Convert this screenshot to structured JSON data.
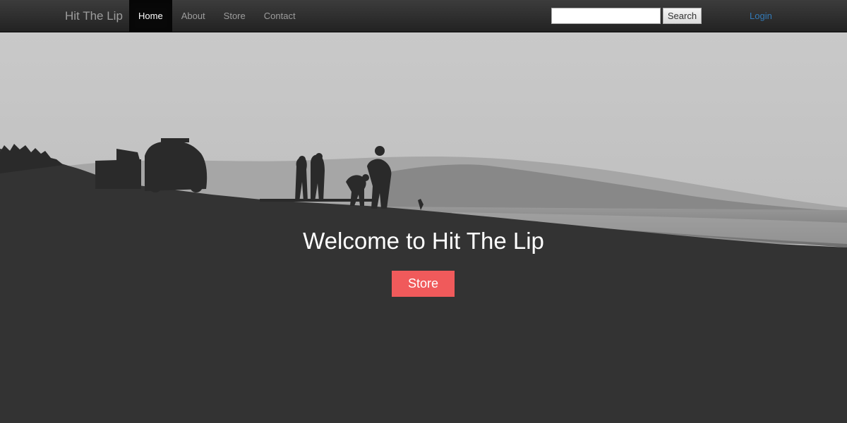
{
  "navbar": {
    "brand": "Hit The Lip",
    "items": [
      {
        "label": "Home",
        "active": true
      },
      {
        "label": "About",
        "active": false
      },
      {
        "label": "Store",
        "active": false
      },
      {
        "label": "Contact",
        "active": false
      }
    ],
    "search": {
      "value": "",
      "placeholder": "",
      "button_label": "Search"
    },
    "login_label": "Login"
  },
  "hero": {
    "title": "Welcome to Hit The Lip",
    "button_label": "Store"
  },
  "colors": {
    "navbar_bg": "#222222",
    "accent_button": "#f05a5b",
    "login_link": "#337ab7",
    "hero_dark": "#333333"
  }
}
